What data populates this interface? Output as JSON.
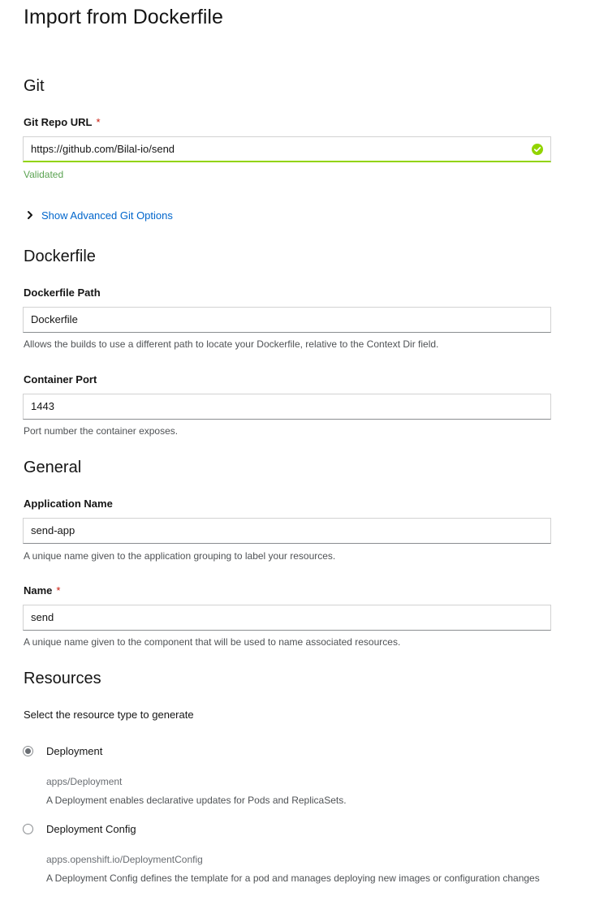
{
  "page": {
    "title": "Import from Dockerfile"
  },
  "git": {
    "section_title": "Git",
    "repo_url_label": "Git Repo URL",
    "required_mark": "*",
    "repo_url_value": "https://github.com/Bilal-io/send",
    "validation_text": "Validated",
    "advanced_toggle_label": "Show Advanced Git Options",
    "status_color": "#92d400"
  },
  "dockerfile": {
    "section_title": "Dockerfile",
    "path_label": "Dockerfile Path",
    "path_value": "Dockerfile",
    "path_helper": "Allows the builds to use a different path to locate your Dockerfile, relative to the Context Dir field.",
    "port_label": "Container Port",
    "port_value": "1443",
    "port_helper": "Port number the container exposes."
  },
  "general": {
    "section_title": "General",
    "app_name_label": "Application Name",
    "app_name_value": "send-app",
    "app_name_helper": "A unique name given to the application grouping to label your resources.",
    "name_label": "Name",
    "required_mark": "*",
    "name_value": "send",
    "name_helper": "A unique name given to the component that will be used to name associated resources."
  },
  "resources": {
    "section_title": "Resources",
    "prompt": "Select the resource type to generate",
    "options": [
      {
        "label": "Deployment",
        "api": "apps/Deployment",
        "description": "A Deployment enables declarative updates for Pods and ReplicaSets.",
        "selected": true
      },
      {
        "label": "Deployment Config",
        "api": "apps.openshift.io/DeploymentConfig",
        "description": "A Deployment Config defines the template for a pod and manages deploying new images or configuration changes",
        "selected": false
      }
    ]
  },
  "icons": {
    "validated": "check-circle-icon",
    "toggle": "chevron-right-icon"
  }
}
